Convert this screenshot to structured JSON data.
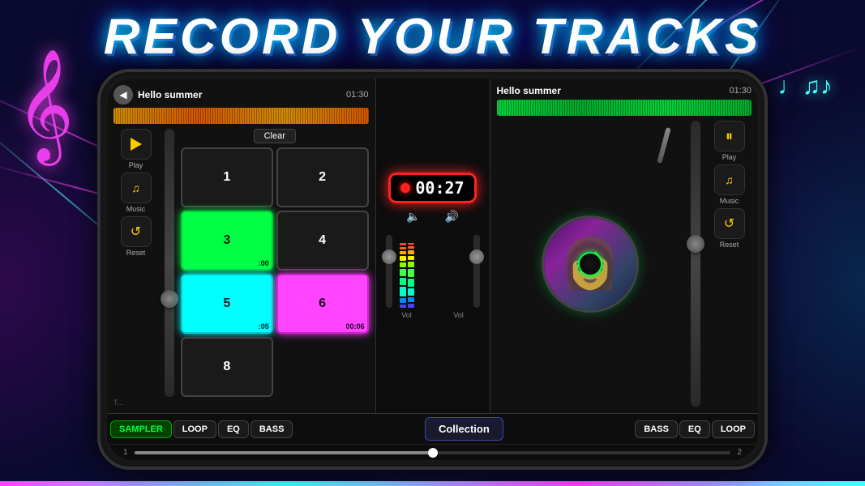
{
  "title": "RECORD YOUR TRACKS",
  "phone": {
    "left_deck": {
      "track_name": "Hello summer",
      "track_time": "01:30",
      "buttons": {
        "play_label": "Play",
        "music_label": "Music",
        "reset_label": "Reset"
      },
      "clear_btn": "Clear",
      "pads": [
        {
          "number": "1",
          "state": "normal",
          "time": ""
        },
        {
          "number": "2",
          "state": "normal",
          "time": ""
        },
        {
          "number": "3",
          "state": "active-green",
          "time": ":00"
        },
        {
          "number": "4",
          "state": "normal",
          "time": ""
        },
        {
          "number": "5",
          "state": "active-cyan",
          "time": ":05"
        },
        {
          "number": "6",
          "state": "active-pink",
          "time": "00:06"
        },
        {
          "number": "8",
          "state": "normal",
          "time": ""
        }
      ]
    },
    "right_deck": {
      "track_name": "Hello summer",
      "track_time": "01:30",
      "buttons": {
        "play_label": "Play",
        "music_label": "Music",
        "reset_label": "Reset"
      }
    },
    "record_time": "00:27",
    "bottom_tabs": {
      "left": [
        "SAMPLER",
        "LOOP",
        "EQ",
        "BASS"
      ],
      "center": "Collection",
      "right": [
        "BASS",
        "EQ",
        "LOOP"
      ]
    },
    "progress": {
      "label_1": "1",
      "label_2": "2"
    },
    "vol_labels": [
      "Vol",
      "Vol"
    ]
  }
}
